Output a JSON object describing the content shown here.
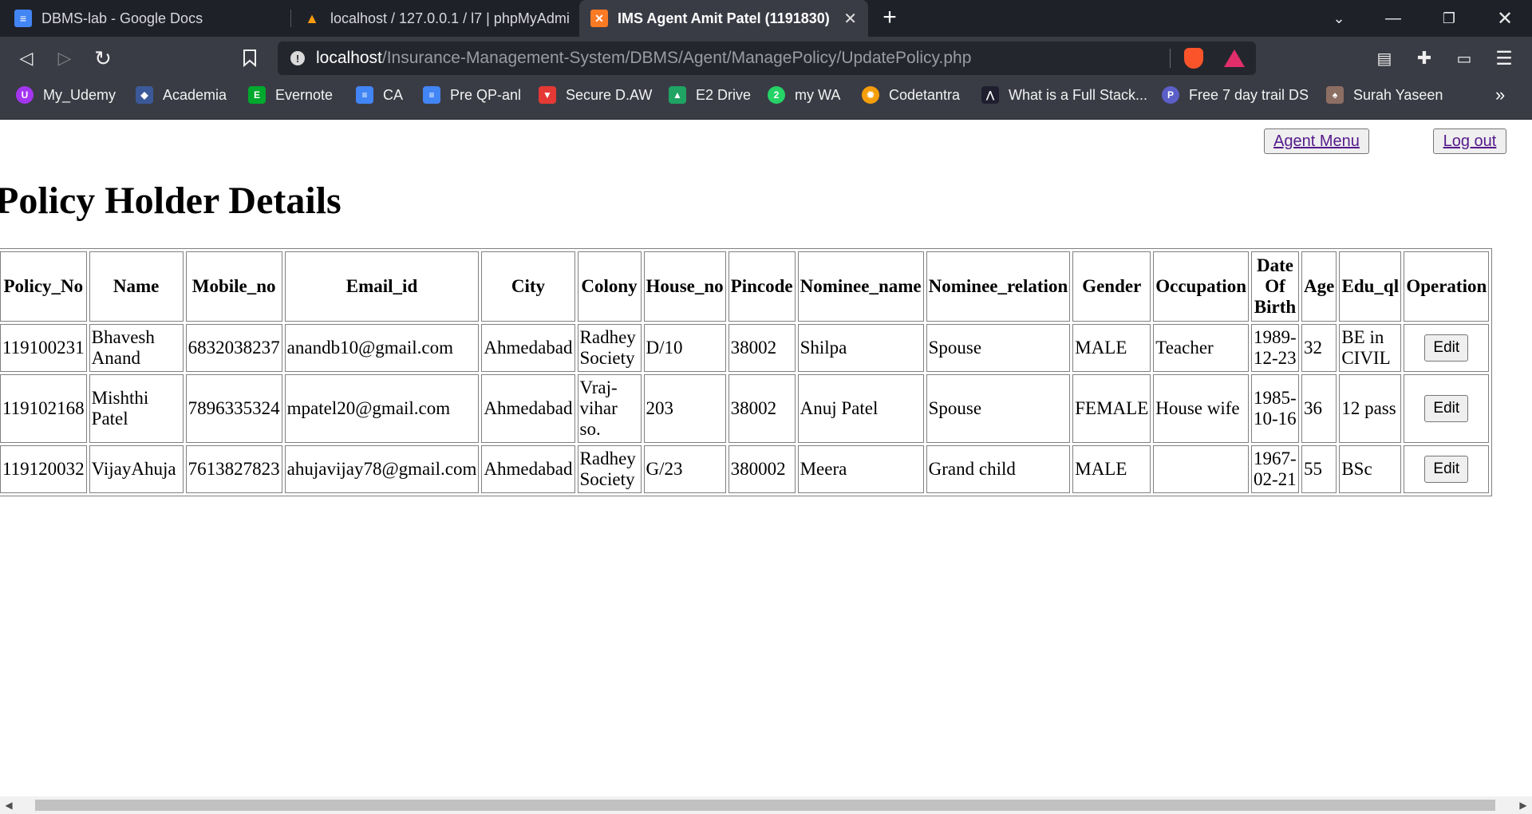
{
  "browser": {
    "tabs": [
      {
        "title": "DBMS-lab - Google Docs",
        "icon": "google-docs-icon",
        "color": "#4285f4"
      },
      {
        "title": "localhost / 127.0.0.1 / l7 | phpMyAdmi",
        "icon": "phpmyadmin-icon",
        "color": "#f89c0e"
      },
      {
        "title": "IMS Agent Amit Patel (1191830)",
        "icon": "xampp-icon",
        "color": "#fb7a24",
        "close": "✕"
      }
    ],
    "new_tab": "+",
    "url": {
      "host": "localhost",
      "path": "/Insurance-Management-System/DBMS/Agent/ManagePolicy/UpdatePolicy.php"
    },
    "bookmarks": [
      {
        "label": "My_Udemy",
        "color": "#a435f0",
        "glyph": "U"
      },
      {
        "label": "Academia",
        "color": "#3b5998",
        "glyph": "◆"
      },
      {
        "label": "Evernote",
        "color": "#00a82d",
        "glyph": "E"
      },
      {
        "label": "CA",
        "color": "#4285f4",
        "glyph": "≡"
      },
      {
        "label": "Pre QP-anl",
        "color": "#4285f4",
        "glyph": "≡"
      },
      {
        "label": "Secure D.AW",
        "color": "#e53935",
        "glyph": "▼"
      },
      {
        "label": "E2 Drive",
        "color": "#1fa463",
        "glyph": "▲"
      },
      {
        "label": "my WA",
        "color": "#25d366",
        "glyph": "2"
      },
      {
        "label": "Codetantra",
        "color": "#f59e0b",
        "glyph": "✹"
      },
      {
        "label": "What is a Full Stack...",
        "color": "#1e1e2e",
        "glyph": "⋀"
      },
      {
        "label": "Free 7 day trail DS",
        "color": "#5b5fc7",
        "glyph": "P"
      },
      {
        "label": "Surah Yaseen",
        "color": "#8d6e63",
        "glyph": "♠"
      }
    ],
    "bookmarks_more": "»"
  },
  "page": {
    "agent_menu_label": "Agent Menu",
    "logout_label": "Log out",
    "title": "Policy Holder Details",
    "table": {
      "headers": [
        "Policy_No",
        "Name",
        "Mobile_no",
        "Email_id",
        "City",
        "Colony",
        "House_no",
        "Pincode",
        "Nominee_name",
        "Nominee_relation",
        "Gender",
        "Occupation",
        "Date Of Birth",
        "Age",
        "Edu_ql",
        "Operation"
      ],
      "rows": [
        [
          "119100231",
          "Bhavesh Anand",
          "6832038237",
          "anandb10@gmail.com",
          "Ahmedabad",
          "Radhey Society",
          "D/10",
          "38002",
          "Shilpa",
          "Spouse",
          "MALE",
          "Teacher",
          "1989-12-23",
          "32",
          "BE in CIVIL",
          "Edit"
        ],
        [
          "119102168",
          "Mishthi Patel",
          "7896335324",
          "mpatel20@gmail.com",
          "Ahmedabad",
          "Vraj-vihar so.",
          "203",
          "38002",
          "Anuj Patel",
          "Spouse",
          "FEMALE",
          "House wife",
          "1985-10-16",
          "36",
          "12 pass",
          "Edit"
        ],
        [
          "119120032",
          "VijayAhuja",
          "7613827823",
          "ahujavijay78@gmail.com",
          "Ahmedabad",
          "Radhey Society",
          "G/23",
          "380002",
          "Meera",
          "Grand child",
          "MALE",
          "",
          "1967-02-21",
          "55",
          "BSc",
          "Edit"
        ]
      ]
    }
  }
}
